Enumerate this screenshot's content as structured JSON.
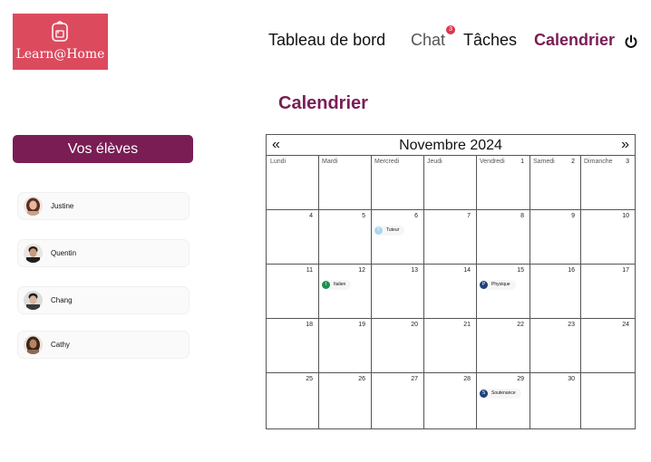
{
  "logo": {
    "text": "Learn@Home",
    "icon": "backpack-icon"
  },
  "nav": {
    "dashboard": "Tableau de bord",
    "chat": "Chat",
    "chat_badge": "3",
    "tasks": "Tâches",
    "calendar": "Calendrier",
    "power_icon": "power-icon"
  },
  "page_title": "Calendrier",
  "students": {
    "header": "Vos élèves",
    "items": [
      {
        "name": "Justine"
      },
      {
        "name": "Quentin"
      },
      {
        "name": "Chang"
      },
      {
        "name": "Cathy"
      }
    ]
  },
  "calendar": {
    "prev": "«",
    "next": "»",
    "month": "Novembre 2024",
    "days": [
      "Lundi",
      "Mardi",
      "Mercredi",
      "Jeudi",
      "Vendredi",
      "Samedi",
      "Dimanche"
    ],
    "weeks": [
      [
        "",
        "",
        "",
        "",
        "1",
        "2",
        "3"
      ],
      [
        "4",
        "5",
        "6",
        "7",
        "8",
        "9",
        "10"
      ],
      [
        "11",
        "12",
        "13",
        "14",
        "15",
        "16",
        "17"
      ],
      [
        "18",
        "19",
        "20",
        "21",
        "22",
        "23",
        "24"
      ],
      [
        "25",
        "26",
        "27",
        "28",
        "29",
        "30",
        ""
      ]
    ],
    "events": [
      {
        "label": "Tuteur",
        "initial": "T",
        "color": "#a8d8f0",
        "week": 1,
        "day": 2
      },
      {
        "label": "Italien",
        "initial": "I",
        "color": "#1f8f4e",
        "week": 2,
        "day": 1
      },
      {
        "label": "Physique",
        "initial": "P",
        "color": "#1f3f7a",
        "week": 2,
        "day": 4
      },
      {
        "label": "Soutenance",
        "initial": "S",
        "color": "#1f3f7a",
        "week": 4,
        "day": 4
      }
    ]
  }
}
